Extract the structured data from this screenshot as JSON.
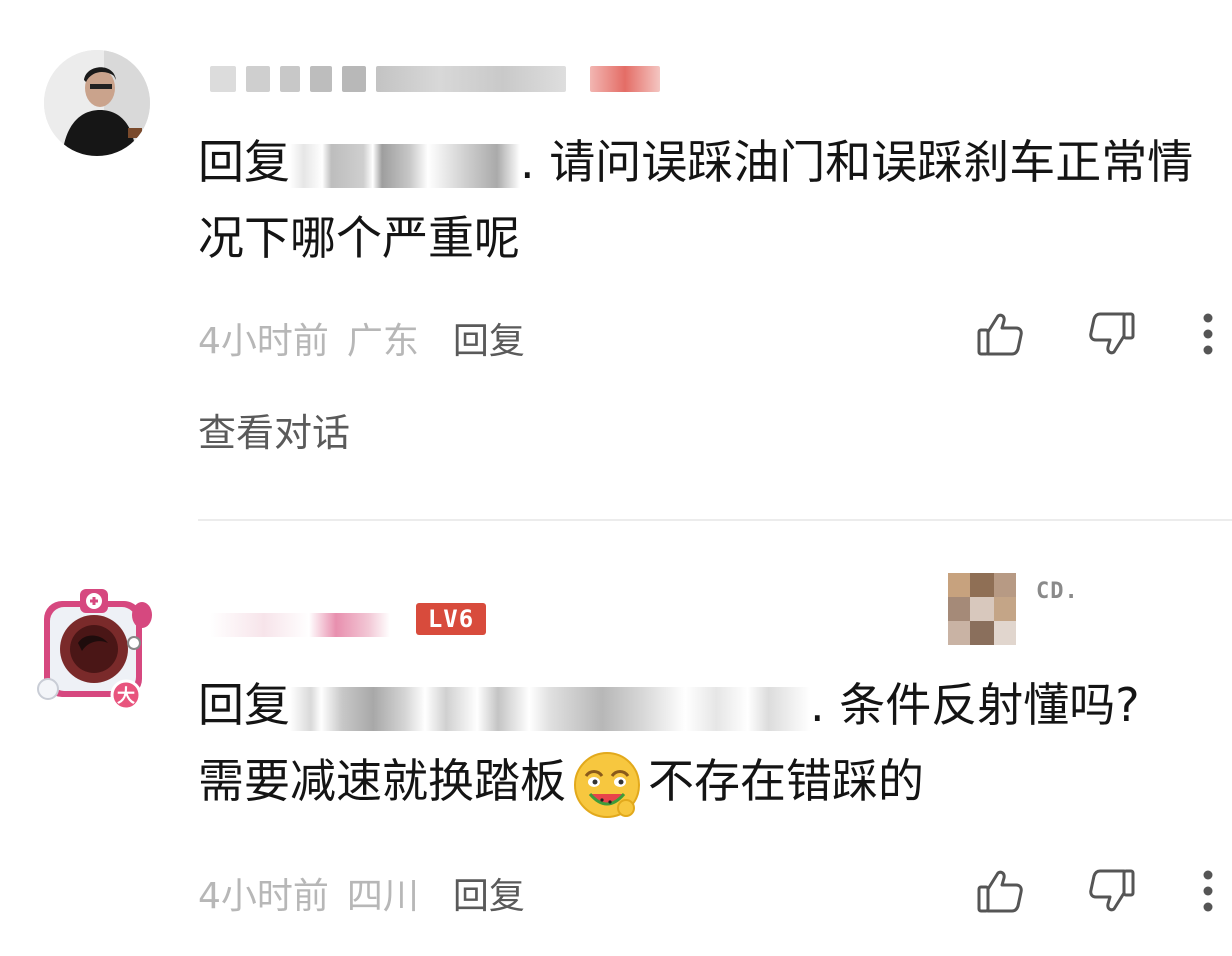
{
  "comments": [
    {
      "reply_prefix": "回复",
      "reply_body": ". 请问误踩油门和误踩刹车正常情况下哪个严重呢",
      "time": "4小时前",
      "location": "广东",
      "reply_label": "回复",
      "view_conversation": "查看对话"
    },
    {
      "level_badge": "LV6",
      "badge_text": "CD.",
      "avatar_tag": "大",
      "reply_prefix": "回复",
      "reply_body_1": ". 条件反射懂吗?",
      "reply_body_2a": "需要减速就换踏板",
      "reply_body_2b": "不存在错踩的",
      "time": "4小时前",
      "location": "四川",
      "reply_label": "回复"
    }
  ],
  "icons": {
    "like": "thumbs-up-icon",
    "dislike": "thumbs-down-icon",
    "more": "more-vertical-icon",
    "emoji": "watermelon-eating-face-emoji"
  },
  "colors": {
    "level_badge": "#d84b3c",
    "meta_gray": "#b7b7b7",
    "link_gray": "#5a5a5a"
  }
}
